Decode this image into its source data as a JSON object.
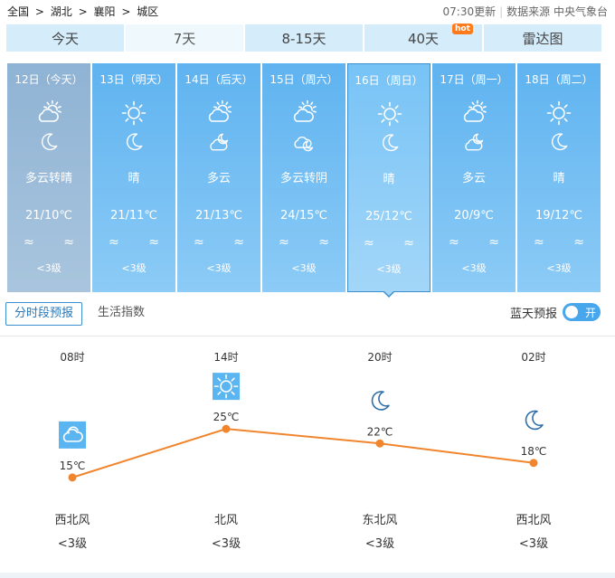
{
  "breadcrumb": [
    "全国",
    ">",
    "湖北",
    ">",
    "襄阳",
    ">",
    "城区"
  ],
  "header": {
    "update_time": "07:30更新",
    "source": "数据来源 中央气象台"
  },
  "tabs": [
    {
      "label": "今天",
      "active": false
    },
    {
      "label": "7天",
      "active": true
    },
    {
      "label": "8-15天",
      "active": false
    },
    {
      "label": "40天",
      "active": false,
      "badge": "hot"
    },
    {
      "label": "雷达图",
      "active": false
    }
  ],
  "days": [
    {
      "date": "12日（今天）",
      "day_icon": "partly-cloudy-sun-icon",
      "night_icon": "moon-icon",
      "desc": "多云转晴",
      "temp": "21/10℃",
      "wind": "≈ ≈",
      "level": "<3级",
      "state": "past"
    },
    {
      "date": "13日（明天）",
      "day_icon": "sun-icon",
      "night_icon": "moon-icon",
      "desc": "晴",
      "temp": "21/11℃",
      "wind": "≈ ≈",
      "level": "<3级",
      "state": "normal"
    },
    {
      "date": "14日（后天）",
      "day_icon": "partly-cloudy-sun-icon",
      "night_icon": "partly-cloudy-moon-icon",
      "desc": "多云",
      "temp": "21/13℃",
      "wind": "≈ ≈",
      "level": "<3级",
      "state": "normal"
    },
    {
      "date": "15日（周六）",
      "day_icon": "partly-cloudy-sun-icon",
      "night_icon": "cloud-moon-icon",
      "desc": "多云转阴",
      "temp": "24/15℃",
      "wind": "≈ ≈",
      "level": "<3级",
      "state": "normal"
    },
    {
      "date": "16日（周日）",
      "day_icon": "sun-icon",
      "night_icon": "moon-icon",
      "desc": "晴",
      "temp": "25/12℃",
      "wind": "≈ ≈",
      "level": "<3级",
      "state": "selected"
    },
    {
      "date": "17日（周一）",
      "day_icon": "partly-cloudy-sun-icon",
      "night_icon": "partly-cloudy-moon-icon",
      "desc": "多云",
      "temp": "20/9℃",
      "wind": "≈ ≈",
      "level": "<3级",
      "state": "normal"
    },
    {
      "date": "18日（周二）",
      "day_icon": "sun-icon",
      "night_icon": "moon-icon",
      "desc": "晴",
      "temp": "19/12℃",
      "wind": "≈ ≈",
      "level": "<3级",
      "state": "normal"
    }
  ],
  "subtabs": [
    {
      "label": "分时段预报",
      "active": true
    },
    {
      "label": "生活指数",
      "active": false
    }
  ],
  "bluesky": {
    "label": "蓝天预报",
    "toggle": "开"
  },
  "colors": {
    "line": "#f0852e",
    "icon_bg": "#5bb5f0",
    "icon_line": "#2f6fa8"
  },
  "hourly": [
    {
      "time": "08时",
      "icon": "cloud-icon",
      "temp": 15,
      "temp_label": "15℃",
      "wind": "西北风",
      "level": "<3级"
    },
    {
      "time": "14时",
      "icon": "sun-icon",
      "temp": 25,
      "temp_label": "25℃",
      "wind": "北风",
      "level": "<3级"
    },
    {
      "time": "20时",
      "icon": "moon-icon",
      "temp": 22,
      "temp_label": "22℃",
      "wind": "东北风",
      "level": "<3级"
    },
    {
      "time": "02时",
      "icon": "moon-icon",
      "temp": 18,
      "temp_label": "18℃",
      "wind": "西北风",
      "level": "<3级"
    }
  ]
}
